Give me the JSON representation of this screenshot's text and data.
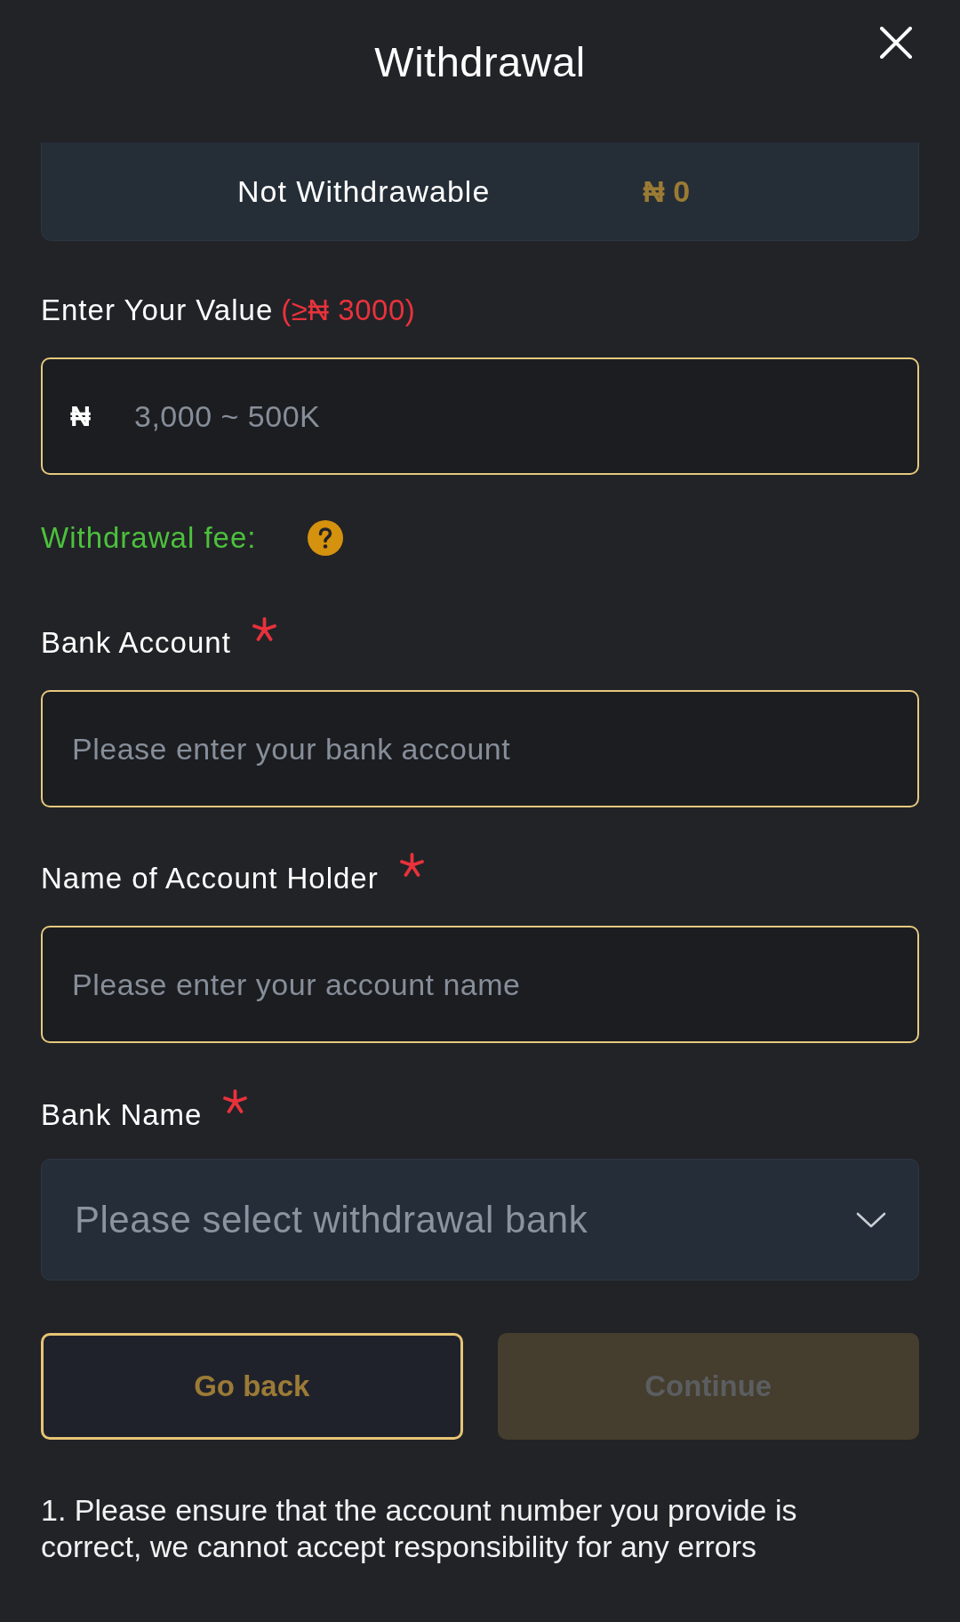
{
  "header": {
    "title": "Withdrawal"
  },
  "balance_card": {
    "label": "Not Withdrawable",
    "amount": "₦ 0"
  },
  "amount_field": {
    "label": "Enter Your Value",
    "hint": "(≥₦ 3000)",
    "prefix": "₦",
    "placeholder": "3,000 ~ 500K"
  },
  "withdrawal_fee": {
    "label": "Withdrawal fee:"
  },
  "fields": [
    {
      "kind": "text",
      "label": "Bank Account",
      "required": true,
      "placeholder": "Please enter your bank account"
    },
    {
      "kind": "text",
      "label": "Name of Account Holder",
      "required": true,
      "placeholder": "Please enter your account name"
    },
    {
      "kind": "select",
      "label": "Bank Name",
      "required": true,
      "placeholder": "Please select withdrawal bank"
    }
  ],
  "buttons": [
    {
      "kind": "secondary",
      "label": "Go back",
      "disabled": false
    },
    {
      "kind": "primary",
      "label": "Continue",
      "disabled": true
    }
  ],
  "notes": [
    "1. Please ensure that the account number you provide is correct, we cannot accept responsibility for any errors"
  ]
}
